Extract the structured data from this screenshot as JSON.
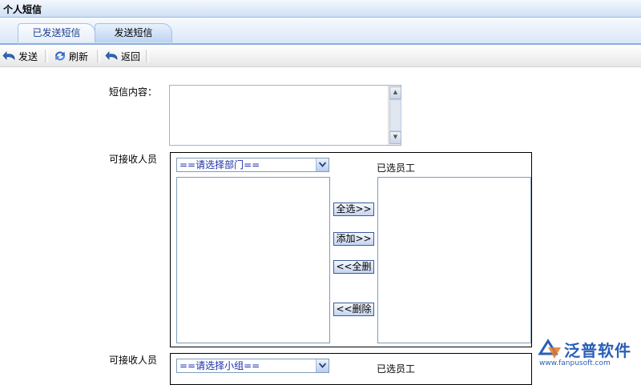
{
  "window": {
    "title": "个人短信"
  },
  "tabs": [
    {
      "label": "已发送短信",
      "active": false
    },
    {
      "label": "发送短信",
      "active": true
    }
  ],
  "toolbar": {
    "send_label": "发送",
    "refresh_label": "刷新",
    "back_label": "返回"
  },
  "form": {
    "content_label": "短信内容：",
    "content_value": "",
    "recipients_label": "可接收人员",
    "dept_select": {
      "value": "==请选择部门=="
    },
    "group_select": {
      "value": "==请选择小组=="
    },
    "selected_label": "已选员工",
    "buttons": {
      "select_all": "全选>>",
      "add": "添加>>",
      "remove_all": "<<全删",
      "remove": "<<删除"
    }
  },
  "branding": {
    "name": "泛普软件",
    "url": "www.fanpusoft.com"
  },
  "colors": {
    "accent": "#2a5fb8",
    "select_text": "#1a2ea8"
  }
}
